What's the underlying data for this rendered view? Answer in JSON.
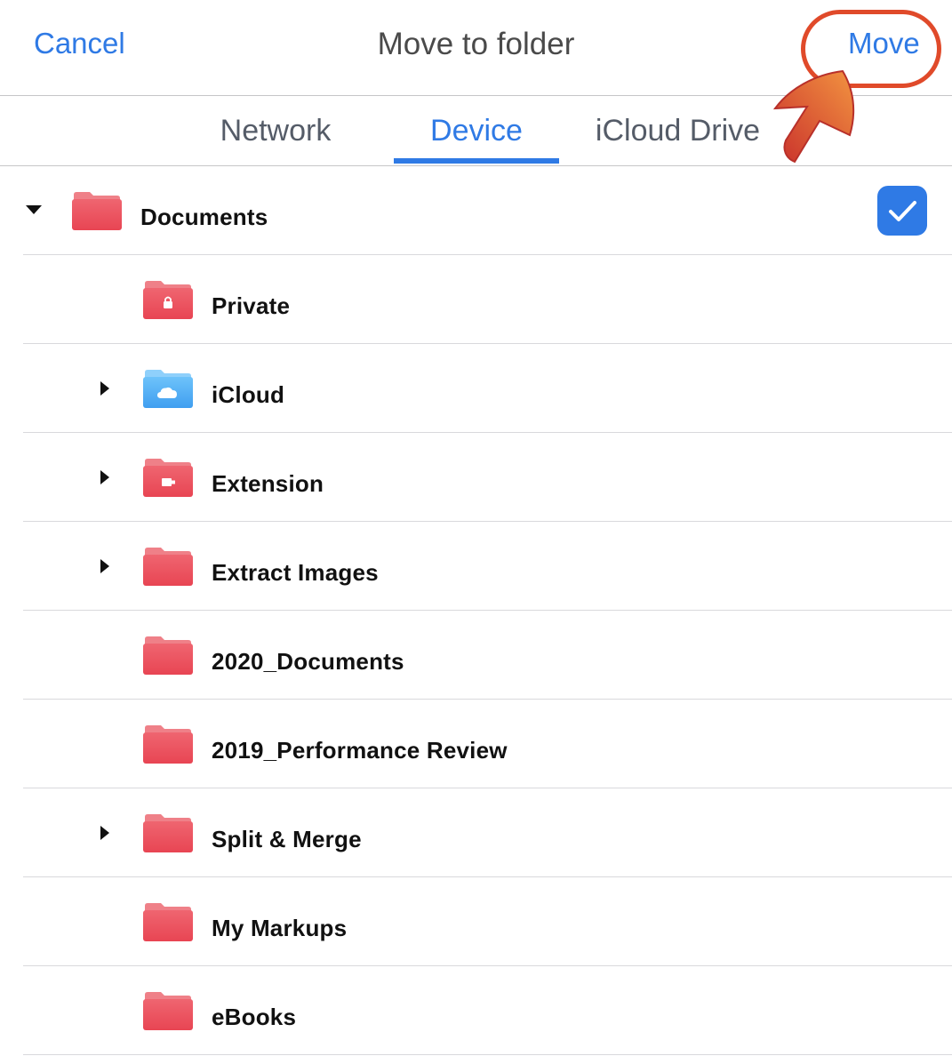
{
  "navbar": {
    "cancel_label": "Cancel",
    "title": "Move to folder",
    "move_label": "Move"
  },
  "tabs": [
    {
      "label": "Network",
      "selected": false
    },
    {
      "label": "Device",
      "selected": true
    },
    {
      "label": "iCloud Drive",
      "selected": false
    }
  ],
  "folders": [
    {
      "name": "Documents",
      "icon": "folder-icon",
      "expandable": true,
      "expanded": true,
      "selected": true,
      "level": 0
    },
    {
      "name": "Private",
      "icon": "lock-folder-icon",
      "expandable": false,
      "level": 1
    },
    {
      "name": "iCloud",
      "icon": "icloud-folder-icon",
      "expandable": true,
      "expanded": false,
      "level": 1
    },
    {
      "name": "Extension",
      "icon": "extension-folder-icon",
      "expandable": true,
      "expanded": false,
      "level": 1
    },
    {
      "name": "Extract Images",
      "icon": "folder-icon",
      "expandable": true,
      "expanded": false,
      "level": 1
    },
    {
      "name": "2020_Documents",
      "icon": "folder-icon",
      "expandable": false,
      "level": 1
    },
    {
      "name": "2019_Performance Review",
      "icon": "folder-icon",
      "expandable": false,
      "level": 1
    },
    {
      "name": "Split & Merge",
      "icon": "folder-icon",
      "expandable": true,
      "expanded": false,
      "level": 1
    },
    {
      "name": "My Markups",
      "icon": "folder-icon",
      "expandable": false,
      "level": 1
    },
    {
      "name": "eBooks",
      "icon": "folder-icon",
      "expandable": false,
      "level": 1
    }
  ],
  "colors": {
    "accent": "#2f7ae5",
    "folder_red": "#ea4d5a",
    "folder_blue": "#48a6f2",
    "highlight": "#e04a2a"
  }
}
